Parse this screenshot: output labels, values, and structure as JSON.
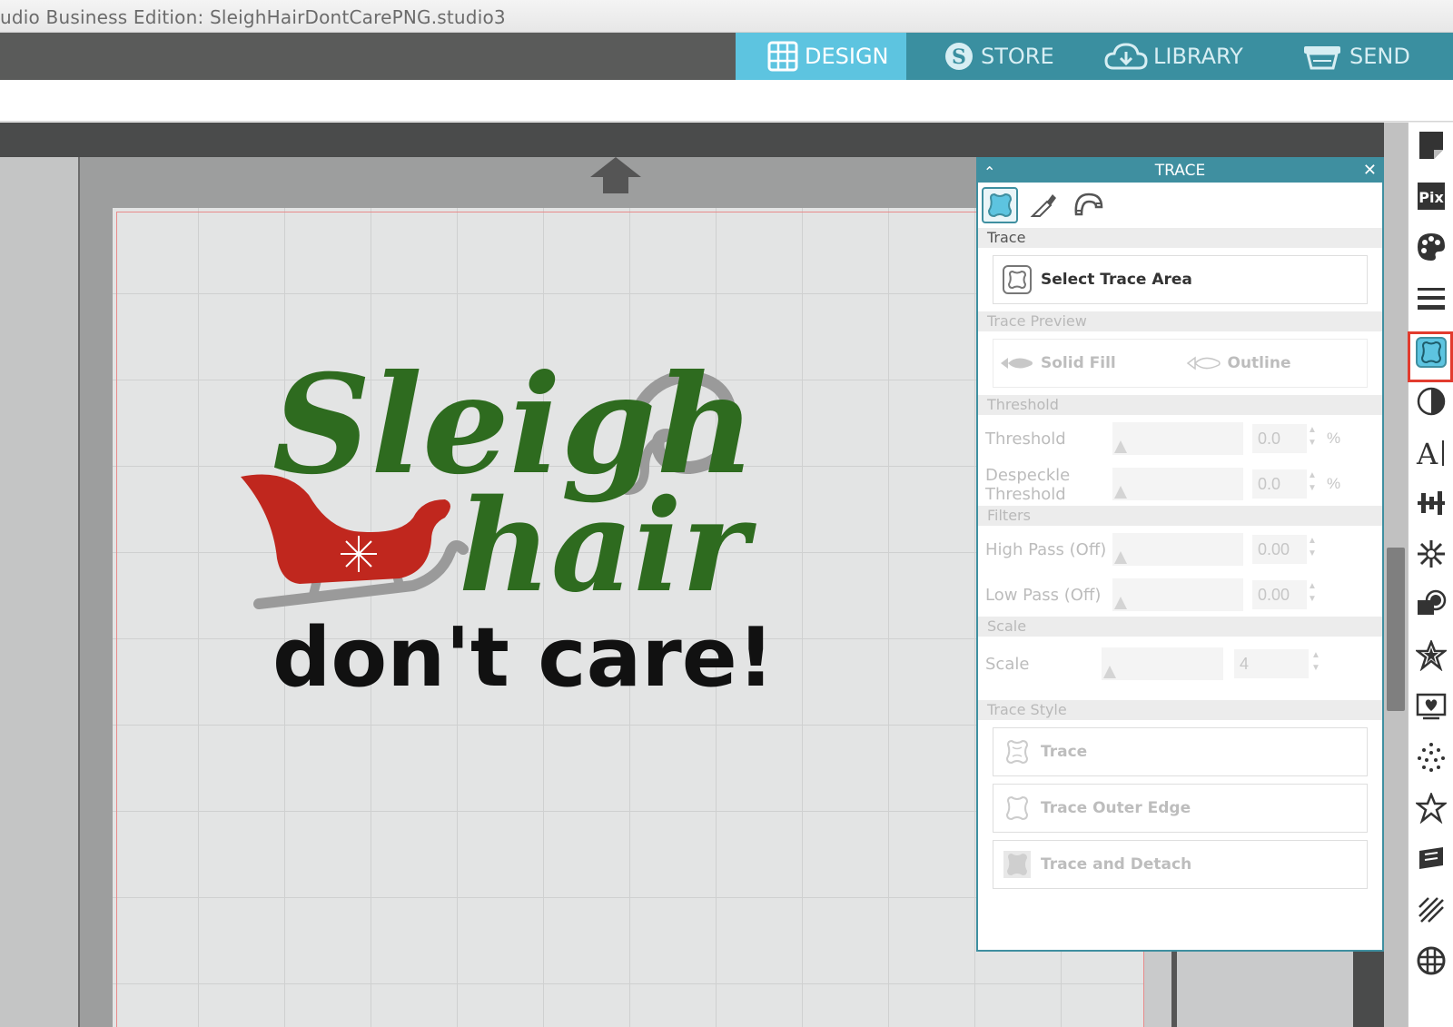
{
  "window": {
    "title": "udio Business Edition: SleighHairDontCarePNG.studio3"
  },
  "nav": {
    "tabs": [
      {
        "label": "DESIGN",
        "icon": "grid-icon"
      },
      {
        "label": "STORE",
        "icon": "silhouette-s-icon"
      },
      {
        "label": "LIBRARY",
        "icon": "cloud-download-icon"
      },
      {
        "label": "SEND",
        "icon": "cutter-icon"
      }
    ],
    "active": "DESIGN"
  },
  "design": {
    "line1": "Sleigh",
    "line2": "hair",
    "line3": "don't care!"
  },
  "trace_panel": {
    "title": "TRACE",
    "tabs": [
      "trace-tab-icon",
      "eyedropper-icon",
      "magnet-icon"
    ],
    "sections": {
      "trace": "Trace",
      "preview": "Trace Preview",
      "threshold": "Threshold",
      "filters": "Filters",
      "scale": "Scale",
      "style": "Trace Style"
    },
    "select_area_label": "Select Trace Area",
    "preview_options": [
      "Solid Fill",
      "Outline"
    ],
    "threshold": {
      "label": "Threshold",
      "value": "0.0",
      "unit": "%"
    },
    "despeckle": {
      "label1": "Despeckle",
      "label2": "Threshold",
      "value": "0.0",
      "unit": "%"
    },
    "high_pass": {
      "label": "High Pass (Off)",
      "value": "0.00"
    },
    "low_pass": {
      "label": "Low Pass (Off)",
      "value": "0.00"
    },
    "scale": {
      "label": "Scale",
      "value": "4"
    },
    "style_buttons": [
      "Trace",
      "Trace Outer Edge",
      "Trace and Detach"
    ]
  },
  "sidebar": {
    "icons": [
      "page-setup-icon",
      "pixscan-icon",
      "fill-color-icon",
      "line-style-icon",
      "trace-icon",
      "image-effects-icon",
      "text-style-icon",
      "transform-icon",
      "replicate-icon",
      "modify-icon",
      "offset-icon",
      "sketch-icon",
      "rhinestone-icon",
      "star-icon",
      "layers-icon",
      "pattern-fill-icon",
      "grid-icon"
    ],
    "highlighted": "trace-icon"
  },
  "colors": {
    "accent": "#3f8fa0",
    "active_tab": "#5dc4e0",
    "green_text": "#2e6b1f",
    "sleigh_red": "#c0271e",
    "highlight_red": "#e23b2e"
  }
}
